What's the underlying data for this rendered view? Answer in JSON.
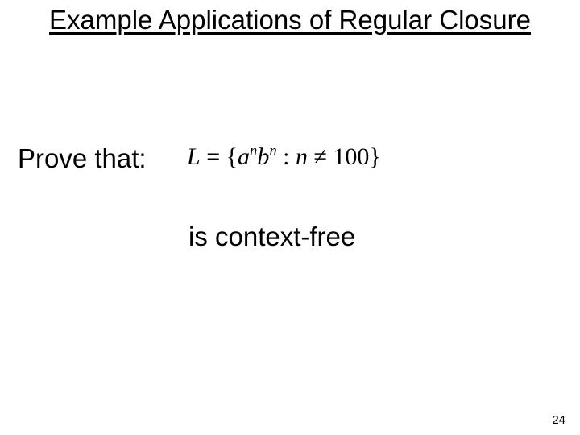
{
  "title": "Example Applications of Regular Closure",
  "prove_label": "Prove that:",
  "formula": {
    "lhs_var": "L",
    "equals": " = ",
    "lbrace": "{",
    "a_base": "a",
    "a_exp": "n",
    "b_base": "b",
    "b_exp": "n",
    "colon": " :  ",
    "cond_var": "n",
    "neq": " ≠ ",
    "cond_val": "100",
    "rbrace": "}"
  },
  "conclusion": "is context-free",
  "page_number": "24"
}
